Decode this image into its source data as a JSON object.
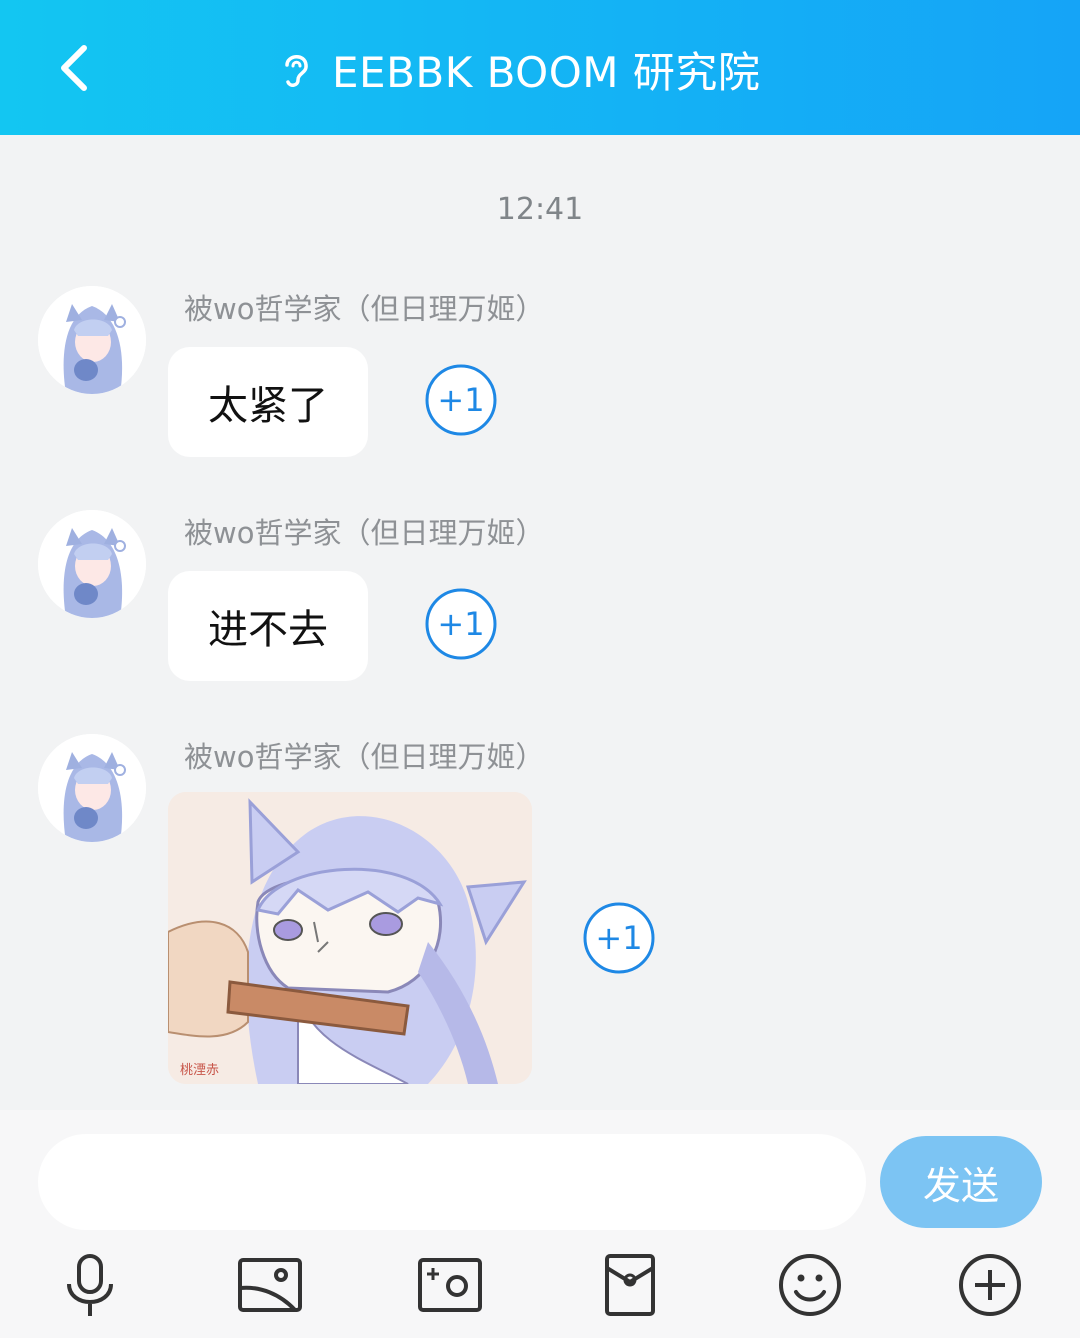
{
  "header": {
    "back_icon": "chevron-left-icon",
    "ear_icon": "ear-icon",
    "title": "EEBBK BOOM 研究院"
  },
  "chat": {
    "timestamp": "12:41",
    "messages": [
      {
        "sender": "被wo哲学家（但日理万姬）",
        "text": "太紧了",
        "plus_one": "+1"
      },
      {
        "sender": "被wo哲学家（但日理万姬）",
        "text": "进不去",
        "plus_one": "+1"
      },
      {
        "sender": "被wo哲学家（但日理万姬）",
        "sticker_watermark": "桃湮赤",
        "plus_one": "+1"
      }
    ]
  },
  "input": {
    "placeholder": "",
    "send_label": "发送"
  },
  "toolbar": {
    "icons": [
      "microphone-icon",
      "image-icon",
      "camera-icon",
      "red-packet-icon",
      "emoji-icon",
      "plus-icon"
    ]
  },
  "colors": {
    "header_start": "#13c6f2",
    "header_end": "#15a4f7",
    "plus_one_blue": "#1e88e5",
    "send_button": "#7cc4f3"
  }
}
